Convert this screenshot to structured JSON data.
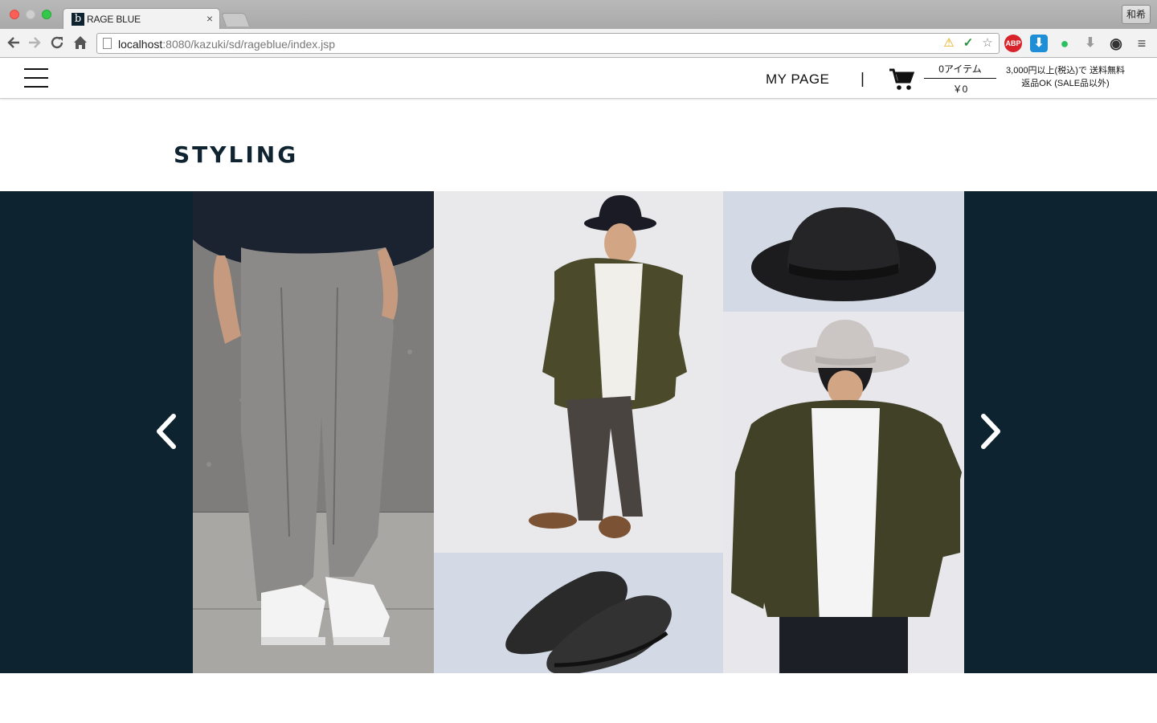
{
  "browser": {
    "tab_title": "RAGE BLUE",
    "tab_favicon_text": "b",
    "url_host": "localhost",
    "url_rest": ":8080/kazuki/sd/rageblue/index.jsp",
    "profile_label": "和希",
    "extensions": [
      "ABP"
    ]
  },
  "header": {
    "mypage_label": "MY PAGE",
    "divider": "|",
    "cart_count": "0アイテム",
    "cart_total": "￥0",
    "shipping_line1": "3,000円以上(税込)で 送料無料",
    "shipping_line2": "返品OK (SALE品以外)"
  },
  "section": {
    "title": "STYLING"
  },
  "carousel": {
    "background": "#0e2330",
    "photos": [
      {
        "name": "look-pants-sneakers"
      },
      {
        "name": "look-khaki-jacket-black-hat"
      },
      {
        "name": "item-black-shoes"
      },
      {
        "name": "item-black-hat"
      },
      {
        "name": "look-khaki-jacket-grey-hat"
      }
    ]
  },
  "colors": {
    "brand_navy": "#0e2330",
    "header_text": "#111111"
  }
}
